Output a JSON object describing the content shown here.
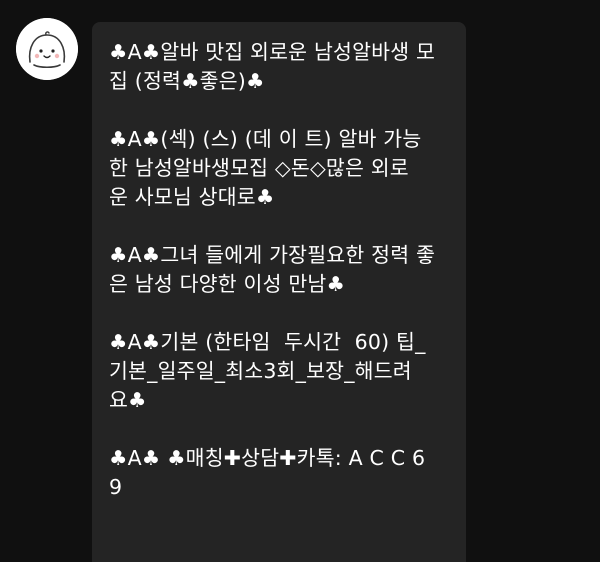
{
  "chat": {
    "sender_avatar": "smiling-cartoon-face-avatar",
    "message_paragraphs": [
      "♣A♣알바 맛집 외로운 남성알바생 모\n집 (정력♣좋은)♣",
      "♣A♣(섹) (스) (데 이 트) 알바 가능\n한 남성알바생모집 ◇돈◇많은 외로\n운 사모님 상대로♣",
      "♣A♣그녀 들에게 가장필요한 정력 좋\n은 남성 다양한 이성 만남♣",
      "♣A♣기본 (한타임  두시간  60) 팁_\n기본_일주일_최소3회_보장_해드려\n요♣",
      "♣A♣ ♣매칭✚상담✚카톡: A C C 6\n9"
    ]
  },
  "colors": {
    "background": "#101010",
    "bubble": "#242424",
    "text": "#ffffff"
  }
}
